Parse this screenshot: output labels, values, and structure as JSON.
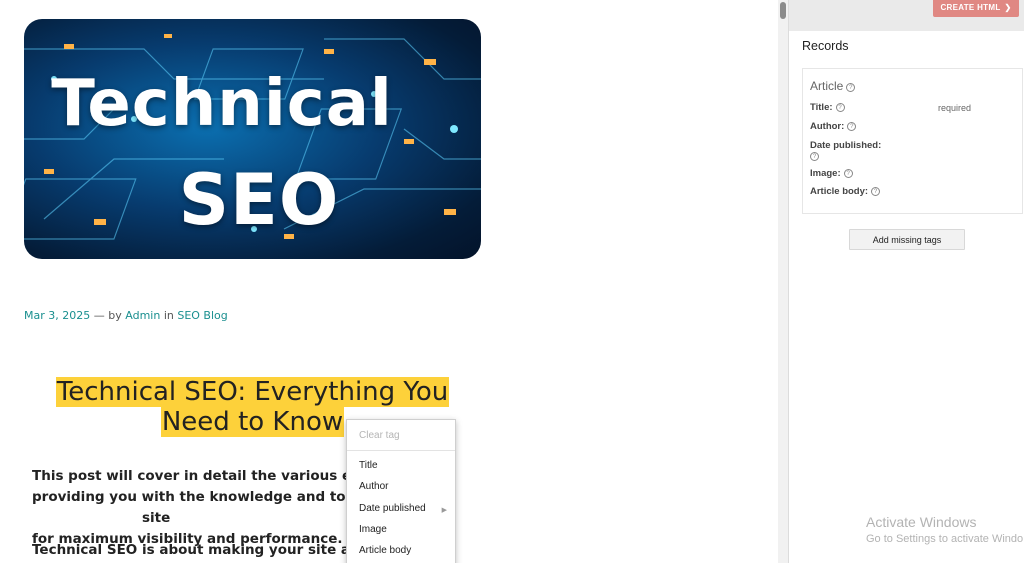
{
  "hero": {
    "line1": "Technical",
    "line2": "SEO",
    "icon": "circuit-board-image"
  },
  "post_meta": {
    "date": "Mar 3, 2025",
    "separator": "—",
    "by": "by",
    "author": "Admin",
    "in": "in",
    "category": "SEO Blog"
  },
  "post": {
    "title_line1": "Technical SEO: Everything You",
    "title_line2": "Need to Know",
    "paragraph1": "This post will cover in detail the various elements",
    "paragraph1_tail": "site",
    "paragraph1_line2_start": "providing you with the knowledge and tools to op",
    "paragraph1_line3": "for maximum visibility and performance.",
    "paragraph2": "Technical SEO is about making your site accessibl"
  },
  "context_menu": {
    "clear_tag": "Clear tag",
    "items": [
      "Title",
      "Author",
      "Date published",
      "Image",
      "Article body"
    ]
  },
  "panel": {
    "create_button": "CREATE HTML",
    "records_title": "Records",
    "article_heading": "Article",
    "fields": {
      "title": "Title:",
      "author": "Author:",
      "date_published": "Date published:",
      "image": "Image:",
      "article_body": "Article body:"
    },
    "required_label": "required",
    "add_missing_button": "Add missing tags"
  },
  "watermark": {
    "title": "Activate Windows",
    "subtitle": "Go to Settings to activate Windo"
  },
  "colors": {
    "link": "#1a8f8f",
    "highlight": "#fdd13a",
    "create_button": "#e08883"
  }
}
